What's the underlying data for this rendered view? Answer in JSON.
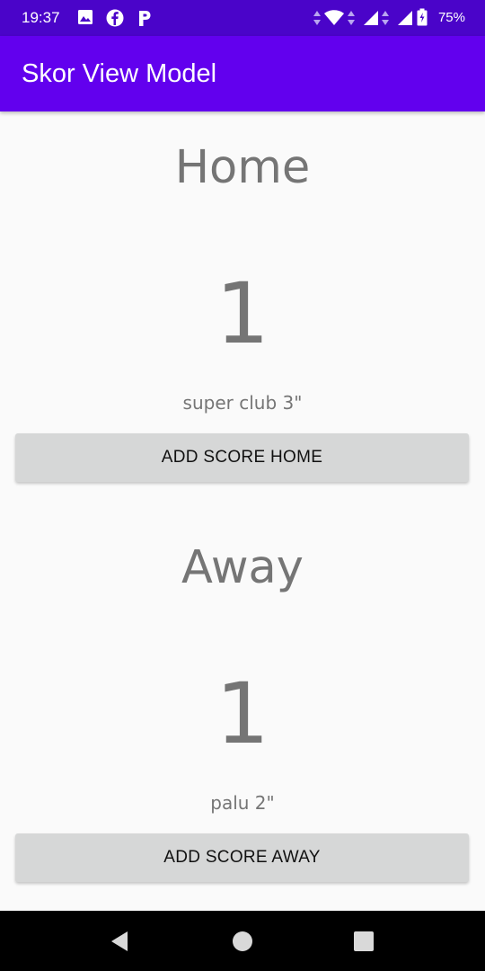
{
  "status_bar": {
    "time": "19:37",
    "battery": "75%",
    "left_icons": [
      "image-icon",
      "facebook-icon",
      "p-icon"
    ],
    "right_icons": [
      "data-arrows-icon",
      "wifi-icon",
      "signal-icon",
      "signal-icon",
      "battery-icon"
    ]
  },
  "app_bar": {
    "title": "Skor View Model"
  },
  "home": {
    "label": "Home",
    "score": "1",
    "scorer": "super club 3\"",
    "button": "ADD SCORE HOME"
  },
  "away": {
    "label": "Away",
    "score": "1",
    "scorer": "palu 2\"",
    "button": "ADD SCORE AWAY"
  },
  "nav_bar": {
    "buttons": [
      "back-icon",
      "home-icon",
      "recents-icon"
    ]
  },
  "colors": {
    "status_bar": "#4a04c9",
    "app_bar": "#6200ee",
    "text_gray": "#757575",
    "button_bg": "#d6d7d7"
  }
}
